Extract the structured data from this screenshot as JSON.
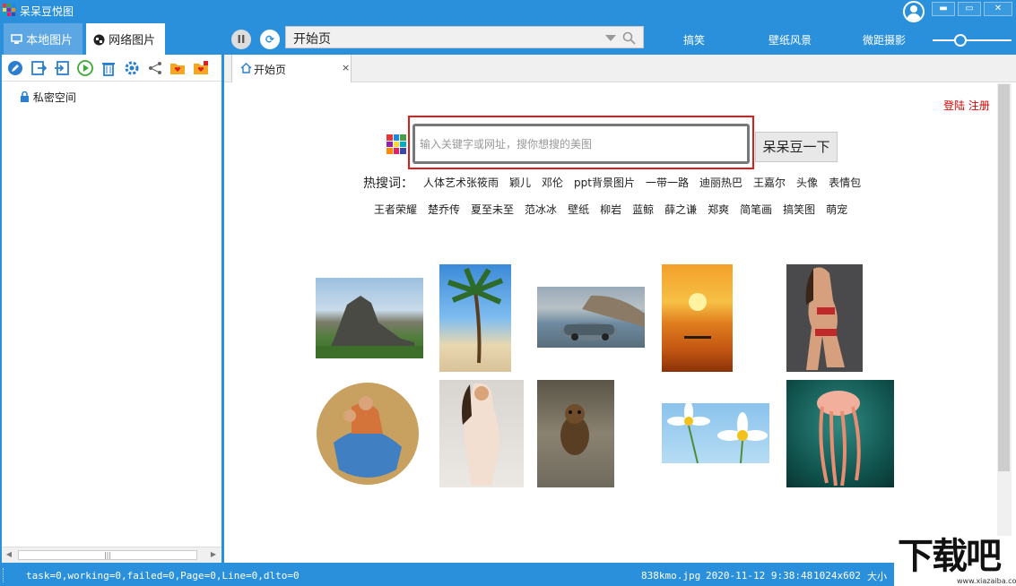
{
  "app": {
    "title": "呆呆豆悦图",
    "logo_colors": [
      "#e53935",
      "#43a047",
      "#1e88e5",
      "#fdd835",
      "#8e24aa",
      "#fb8c00",
      "#00acc1",
      "#e91e63",
      "#3949ab"
    ]
  },
  "window": {
    "minimize": "▬",
    "maximize": "▭",
    "close": "✕"
  },
  "left_tabs": [
    {
      "label": "本地图片"
    },
    {
      "label": "网络图片"
    }
  ],
  "nav": {
    "pause": "II",
    "refresh": "⟳",
    "address": "开始页",
    "links": [
      "搞笑",
      "壁纸风景",
      "微距摄影"
    ],
    "zoom_level": 0.35
  },
  "sidebar": {
    "tree": [
      {
        "label": "私密空间"
      }
    ]
  },
  "page_tab": {
    "label": "开始页",
    "close": "×"
  },
  "start_page": {
    "login": "登陆 注册",
    "search_placeholder": "输入关键字或网址，搜你想搜的美图",
    "search_button": "呆呆豆一下",
    "hot_label": "热搜词：",
    "hot_row1": [
      "人体艺术张筱雨",
      "颖儿",
      "邓伦",
      "ppt背景图片",
      "一带一路",
      "迪丽热巴",
      "王嘉尔",
      "头像",
      "表情包"
    ],
    "hot_row2": [
      "王者荣耀",
      "楚乔传",
      "夏至未至",
      "范冰冰",
      "壁纸",
      "柳岩",
      "蓝鲸",
      "薛之谦",
      "郑爽",
      "简笔画",
      "搞笑图",
      "萌宠"
    ]
  },
  "status": {
    "left": "task=0,working=0,failed=0,Page=0,Line=0,dlto=0",
    "file": "838kmo.jpg",
    "time": "2020-11-12 9:38:48",
    "dimensions": "1024x602",
    "size": "大小"
  },
  "watermark": {
    "text": "下载吧",
    "url": "www.xiazaiba.com"
  }
}
